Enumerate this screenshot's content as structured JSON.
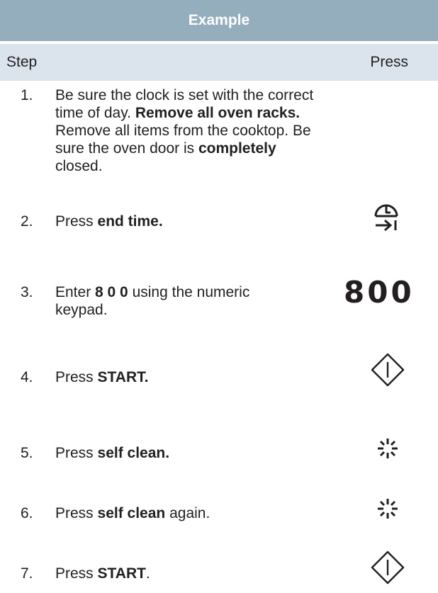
{
  "table": {
    "title": "Example",
    "header": {
      "step": "Step",
      "press": "Press"
    }
  },
  "steps": [
    {
      "num": "1.",
      "parts": [
        "Be sure the clock is set with the correct time of day. ",
        "Remove all oven racks.",
        " Remove all items from the cooktop. Be sure the oven door is ",
        "completely",
        " closed."
      ]
    },
    {
      "num": "2.",
      "parts": [
        "Press ",
        "end time.",
        ""
      ],
      "icon": "end-time-icon"
    },
    {
      "num": "3.",
      "parts": [
        "Enter ",
        "8 0 0",
        " using the numeric keypad."
      ],
      "press_text": "800"
    },
    {
      "num": "4.",
      "parts": [
        "Press ",
        "START.",
        ""
      ],
      "icon": "start-icon"
    },
    {
      "num": "5.",
      "parts": [
        "Press ",
        "self clean.",
        ""
      ],
      "icon": "self-clean-icon"
    },
    {
      "num": "6.",
      "parts": [
        "Press ",
        "self clean",
        " again."
      ],
      "icon": "self-clean-icon"
    },
    {
      "num": "7.",
      "parts": [
        "Press ",
        "START",
        "."
      ],
      "icon": "start-icon"
    }
  ],
  "colors": {
    "title_bar": "#94aebe",
    "header_bar": "#dbe4ec",
    "text": "#231f20"
  }
}
